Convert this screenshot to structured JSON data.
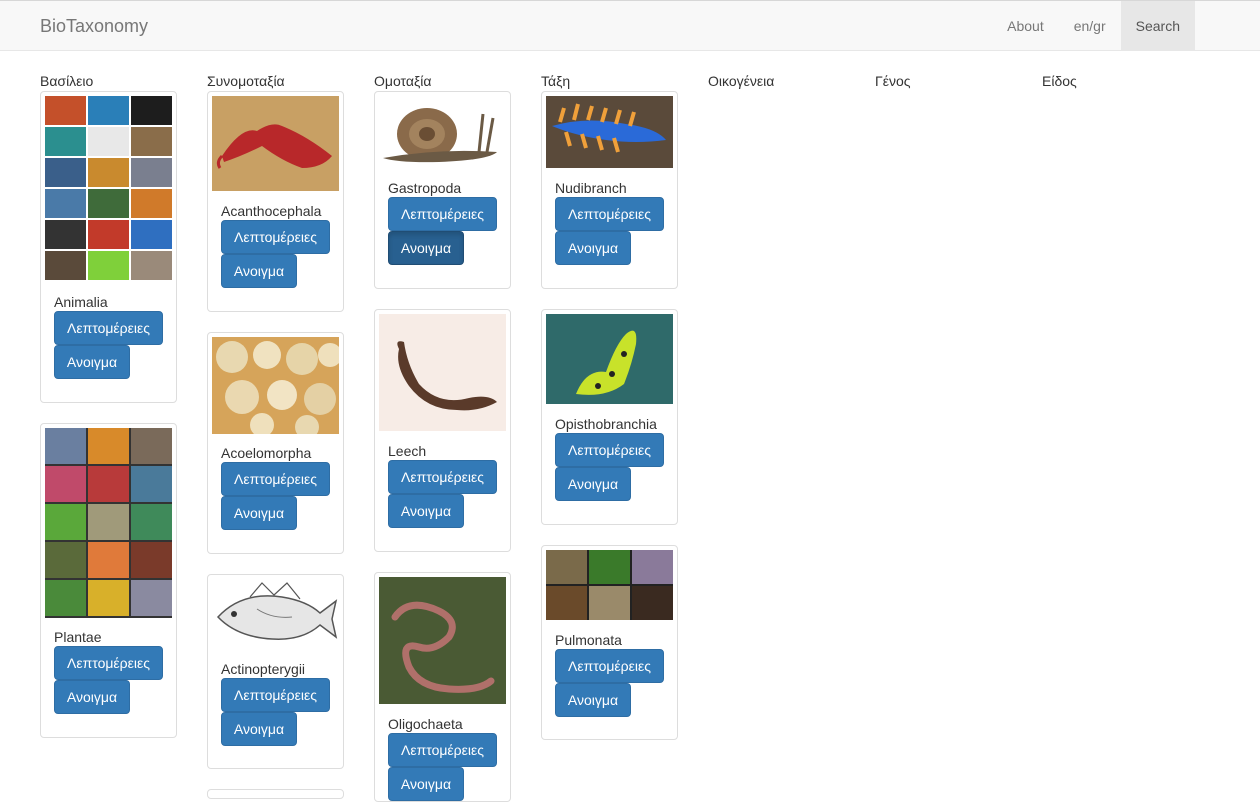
{
  "nav": {
    "brand": "BioTaxonomy",
    "items": [
      "About",
      "en/gr",
      "Search"
    ]
  },
  "columns": [
    "Βασίλειο",
    "Συνομοταξία",
    "Ομοταξία",
    "Τάξη",
    "Οικογένεια",
    "Γένος",
    "Είδος"
  ],
  "buttons": {
    "details": "Λεπτομέρειες",
    "open": "Ανοιγμα"
  },
  "kingdom": [
    {
      "name": "Animalia"
    },
    {
      "name": "Plantae"
    }
  ],
  "phylum": [
    {
      "name": "Acanthocephala"
    },
    {
      "name": "Acoelomorpha"
    },
    {
      "name": "Actinopterygii"
    }
  ],
  "class": [
    {
      "name": "Gastropoda"
    },
    {
      "name": "Leech"
    },
    {
      "name": "Oligochaeta"
    }
  ],
  "order": [
    {
      "name": "Nudibranch"
    },
    {
      "name": "Opisthobranchia"
    },
    {
      "name": "Pulmonata"
    }
  ]
}
